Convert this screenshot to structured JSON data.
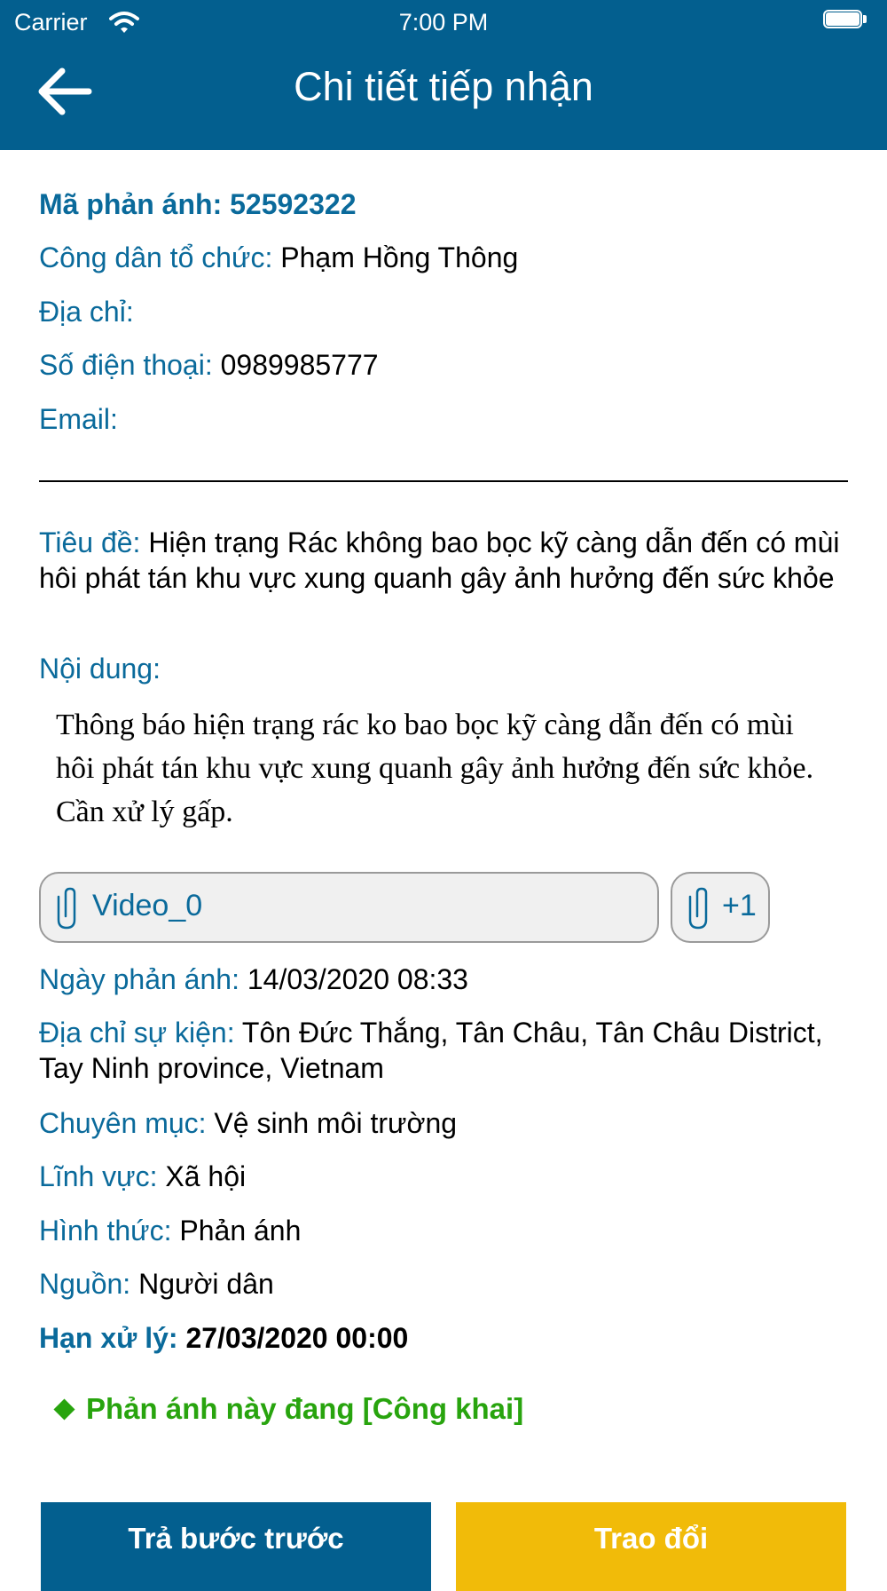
{
  "status_bar": {
    "carrier": "Carrier",
    "time": "7:00 PM"
  },
  "header": {
    "title": "Chi tiết tiếp nhận"
  },
  "detail": {
    "code_label": "Mã phản ánh:",
    "code_value": "52592322",
    "citizen_label": "Công dân tổ chức:",
    "citizen_value": "Phạm Hồng Thông",
    "address_label": "Địa chỉ:",
    "address_value": "",
    "phone_label": "Số điện thoại:",
    "phone_value": "0989985777",
    "email_label": "Email:",
    "email_value": "",
    "title_label": "Tiêu đề:",
    "title_value": "Hiện  trạng Rác không bao bọc kỹ  càng dẫn đến có mùi hôi phát tán khu vực xung quanh gây ảnh hưởng đến sức khỏe",
    "content_label": "Nội dung:",
    "content_value": "Thông báo hiện trạng rác ko bao bọc kỹ càng dẫn đến có mùi hôi phát tán khu vực xung quanh gây ảnh hưởng đến sức khỏe. Cần xử lý gấp.",
    "date_label": "Ngày phản ánh:",
    "date_value": "14/03/2020 08:33",
    "event_address_label": "Địa chỉ sự kiện:",
    "event_address_value": "Tôn Đức Thắng, Tân Châu, Tân Châu District, Tay Ninh province, Vietnam",
    "category_label": "Chuyên mục:",
    "category_value": "Vệ sinh môi trường",
    "field_label": "Lĩnh vực:",
    "field_value": "Xã hội",
    "form_label": "Hình thức:",
    "form_value": "Phản ánh",
    "source_label": "Nguồn:",
    "source_value": "Người dân",
    "deadline_label": "Hạn xử lý:",
    "deadline_value": "27/03/2020 00:00"
  },
  "attachments": {
    "first_label": "Video_0",
    "more_label": "+1",
    "icon": "paperclip-icon"
  },
  "public_note": "Phản ánh này đang [Công khai]",
  "buttons": {
    "back_label": "Trả bước trước",
    "exchange_label": "Trao đổi"
  },
  "colors": {
    "header": "#035f8f",
    "label": "#0a6a9b",
    "public": "#28a40e",
    "exchange_button": "#f1bb09"
  }
}
